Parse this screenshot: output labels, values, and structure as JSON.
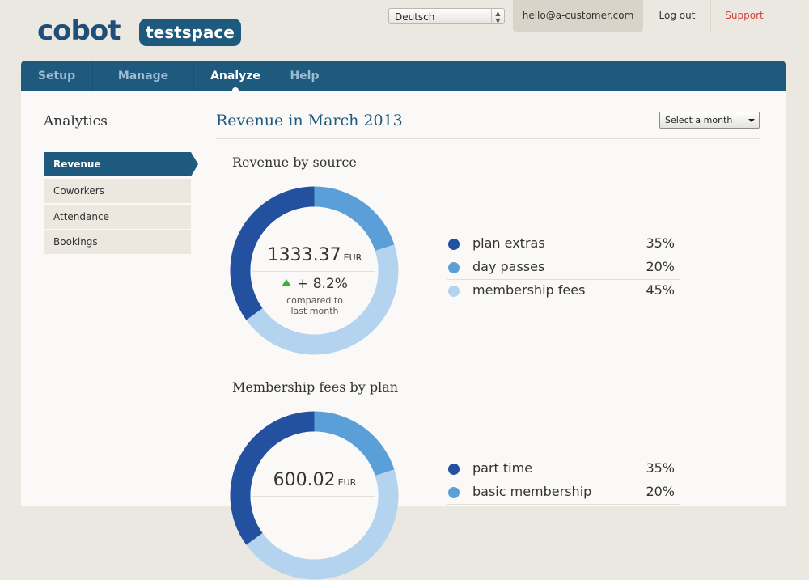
{
  "header": {
    "logo_text": "cobot",
    "space_name": "testspace",
    "language": "Deutsch",
    "user_email": "hello@a-customer.com",
    "logout_label": "Log out",
    "support_label": "Support"
  },
  "nav": {
    "tabs": [
      {
        "label": "Setup"
      },
      {
        "label": "Manage"
      },
      {
        "label": "Analyze",
        "active": true
      },
      {
        "label": "Help"
      }
    ]
  },
  "sidebar": {
    "title": "Analytics",
    "items": [
      {
        "label": "Revenue",
        "active": true
      },
      {
        "label": "Coworkers"
      },
      {
        "label": "Attendance"
      },
      {
        "label": "Bookings"
      }
    ]
  },
  "main": {
    "title": "Revenue in March 2013",
    "month_select": "Select a month",
    "sections": [
      {
        "title": "Revenue by source",
        "amount": "1333.37",
        "currency": "EUR",
        "change": "+ 8.2%",
        "change_note_line1": "compared to",
        "change_note_line2": "last month",
        "legend": [
          {
            "label": "plan extras",
            "pct": "35%",
            "color": "#2450a0",
            "value": 35
          },
          {
            "label": "day passes",
            "pct": "20%",
            "color": "#5b9fd8",
            "value": 20
          },
          {
            "label": "membership fees",
            "pct": "45%",
            "color": "#b3d3ef",
            "value": 45
          }
        ]
      },
      {
        "title": "Membership fees by plan",
        "amount": "600.02",
        "currency": "EUR",
        "legend": [
          {
            "label": "part time",
            "pct": "35%",
            "color": "#2450a0",
            "value": 35
          },
          {
            "label": "basic membership",
            "pct": "20%",
            "color": "#5b9fd8",
            "value": 20
          }
        ]
      }
    ]
  },
  "colors": {
    "brand": "#1d5a7e",
    "support": "#d0453a",
    "positive": "#3cae3a"
  }
}
